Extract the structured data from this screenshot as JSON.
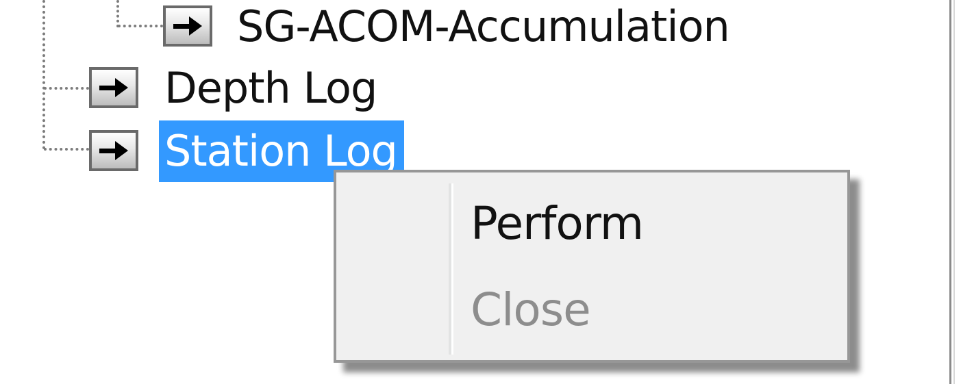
{
  "tree": {
    "nodes": [
      {
        "label": "SG-ACOM-Accumulation",
        "icon": "arrow-right-icon",
        "level": 2,
        "selected": false
      },
      {
        "label": "Depth Log",
        "icon": "arrow-right-icon",
        "level": 1,
        "selected": false
      },
      {
        "label": "Station Log",
        "icon": "arrow-right-icon",
        "level": 1,
        "selected": true
      }
    ]
  },
  "context_menu": {
    "items": [
      {
        "label": "Perform",
        "enabled": true
      },
      {
        "label": "Close",
        "enabled": false
      }
    ]
  },
  "colors": {
    "selection": "#3399ff",
    "menu_background": "#f0f0f0",
    "disabled_text": "#8d8d8d"
  }
}
